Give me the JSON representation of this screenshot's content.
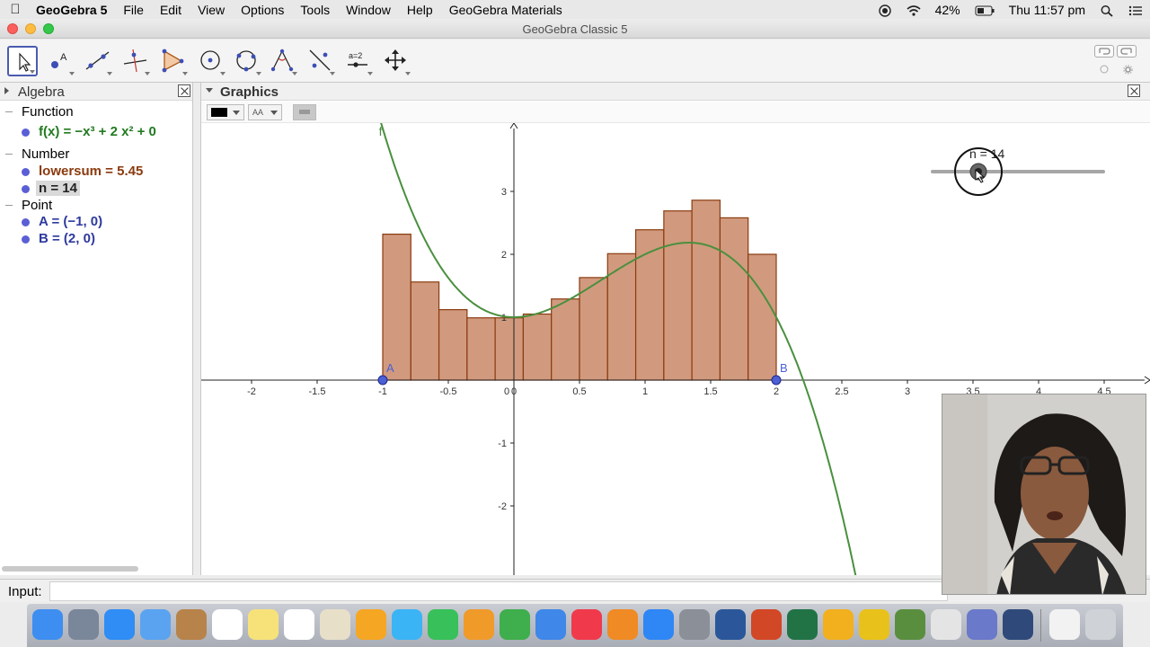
{
  "menubar": {
    "app_name": "GeoGebra 5",
    "menus": [
      "File",
      "Edit",
      "View",
      "Options",
      "Tools",
      "Window",
      "Help",
      "GeoGebra Materials"
    ],
    "battery": "42%",
    "clock": "Thu 11:57 pm"
  },
  "window": {
    "title": "GeoGebra Classic 5"
  },
  "toolbar": {
    "tools": [
      "move-tool",
      "point-tool",
      "line-tool",
      "perpendicular-line-tool",
      "polygon-tool",
      "circle-tool",
      "circle-through-points-tool",
      "angle-tool",
      "reflect-tool",
      "slider-tool",
      "move-graphics-view-tool"
    ],
    "slider_tool_label": "a=2"
  },
  "algebra": {
    "title": "Algebra",
    "categories": {
      "function": "Function",
      "number": "Number",
      "point": "Point"
    },
    "objects": {
      "f": "f(x) = −x³ + 2 x² + 0",
      "lowersum": "lowersum = 5.45",
      "n": "n = 14",
      "A": "A = (−1, 0)",
      "B": "B = (2, 0)"
    }
  },
  "graphics": {
    "title": "Graphics",
    "style_bar": {
      "font_button": "AA"
    },
    "function_label": "f",
    "point_labels": [
      "A",
      "B"
    ],
    "slider_label": "n = 14",
    "colors": {
      "function": "#4a8f3f",
      "bars_fill": "#d19a7e",
      "bars_stroke": "#8a3b10",
      "points": "#4c5fd5"
    }
  },
  "chart_data": {
    "type": "bar",
    "x": [
      -1,
      -0.7857,
      -0.5714,
      -0.3571,
      -0.1429,
      0.0714,
      0.2857,
      0.5,
      0.7143,
      0.9286,
      1.1429,
      1.3571,
      1.5714,
      1.7857,
      2
    ],
    "values": [
      2.32,
      1.56,
      1.12,
      0.99,
      0.99,
      1.05,
      1.29,
      1.63,
      2.01,
      2.39,
      2.69,
      2.86,
      2.58,
      2.0
    ],
    "function": "-x^3 + 2x^2 + 1",
    "xlim": [
      -2.4,
      4.8
    ],
    "ylim": [
      -3,
      4
    ],
    "x_ticks": [
      -2,
      -1.5,
      -1,
      -0.5,
      0,
      0.5,
      1,
      1.5,
      2,
      2.5,
      3,
      3.5,
      4,
      4.5
    ],
    "y_ticks": [
      -2,
      -1,
      1,
      2,
      3
    ],
    "points": [
      {
        "label": "A",
        "x": -1,
        "y": 0
      },
      {
        "label": "B",
        "x": 2,
        "y": 0
      }
    ],
    "slider": {
      "name": "n",
      "value": 14
    }
  },
  "input": {
    "label": "Input:",
    "value": "",
    "placeholder": ""
  }
}
